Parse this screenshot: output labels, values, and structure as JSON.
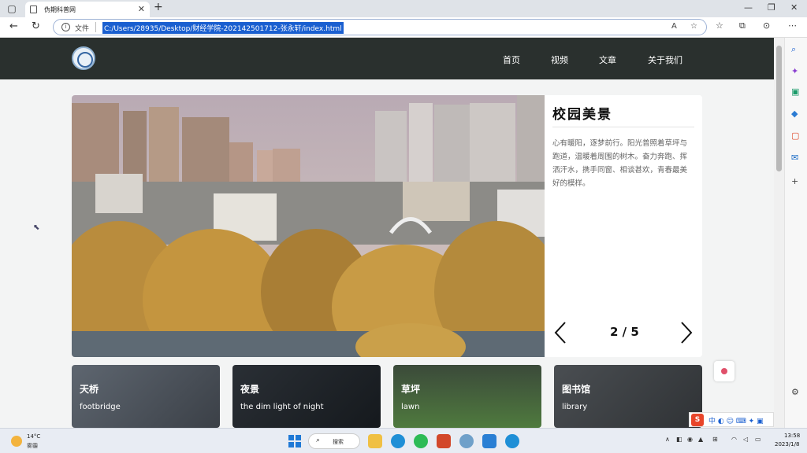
{
  "browser": {
    "tab_title": "伪期科普网",
    "url_scheme": "文件",
    "url": "C:/Users/28935/Desktop/财经学院-202142501712-张永轩/index.html"
  },
  "site": {
    "nav": [
      "首页",
      "视频",
      "文章",
      "关于我们"
    ],
    "hero": {
      "title": "校园美景",
      "description": "心有暖阳，逐梦前行。阳光普照着草坪与跑道，温暖着周围的树木。奋力奔跑、挥洒汗水，携手同窗、相谈甚欢，青春最美好的模样。",
      "counter": "2 / 5"
    },
    "cards": [
      {
        "title": "天桥",
        "subtitle": "footbridge"
      },
      {
        "title": "夜景",
        "subtitle": "the dim light of night"
      },
      {
        "title": "草坪",
        "subtitle": "lawn"
      },
      {
        "title": "图书馆",
        "subtitle": "library"
      }
    ]
  },
  "taskbar": {
    "weather_temp": "14°C",
    "weather_desc": "雾霾",
    "search_label": "搜索",
    "ime_text": "中 ◐ ☺ ⌨ ✦ ▣",
    "time": "13:58",
    "date": "2023/1/8"
  },
  "colors": {
    "header": "#2a302e",
    "accent": "#1a5fd0"
  }
}
